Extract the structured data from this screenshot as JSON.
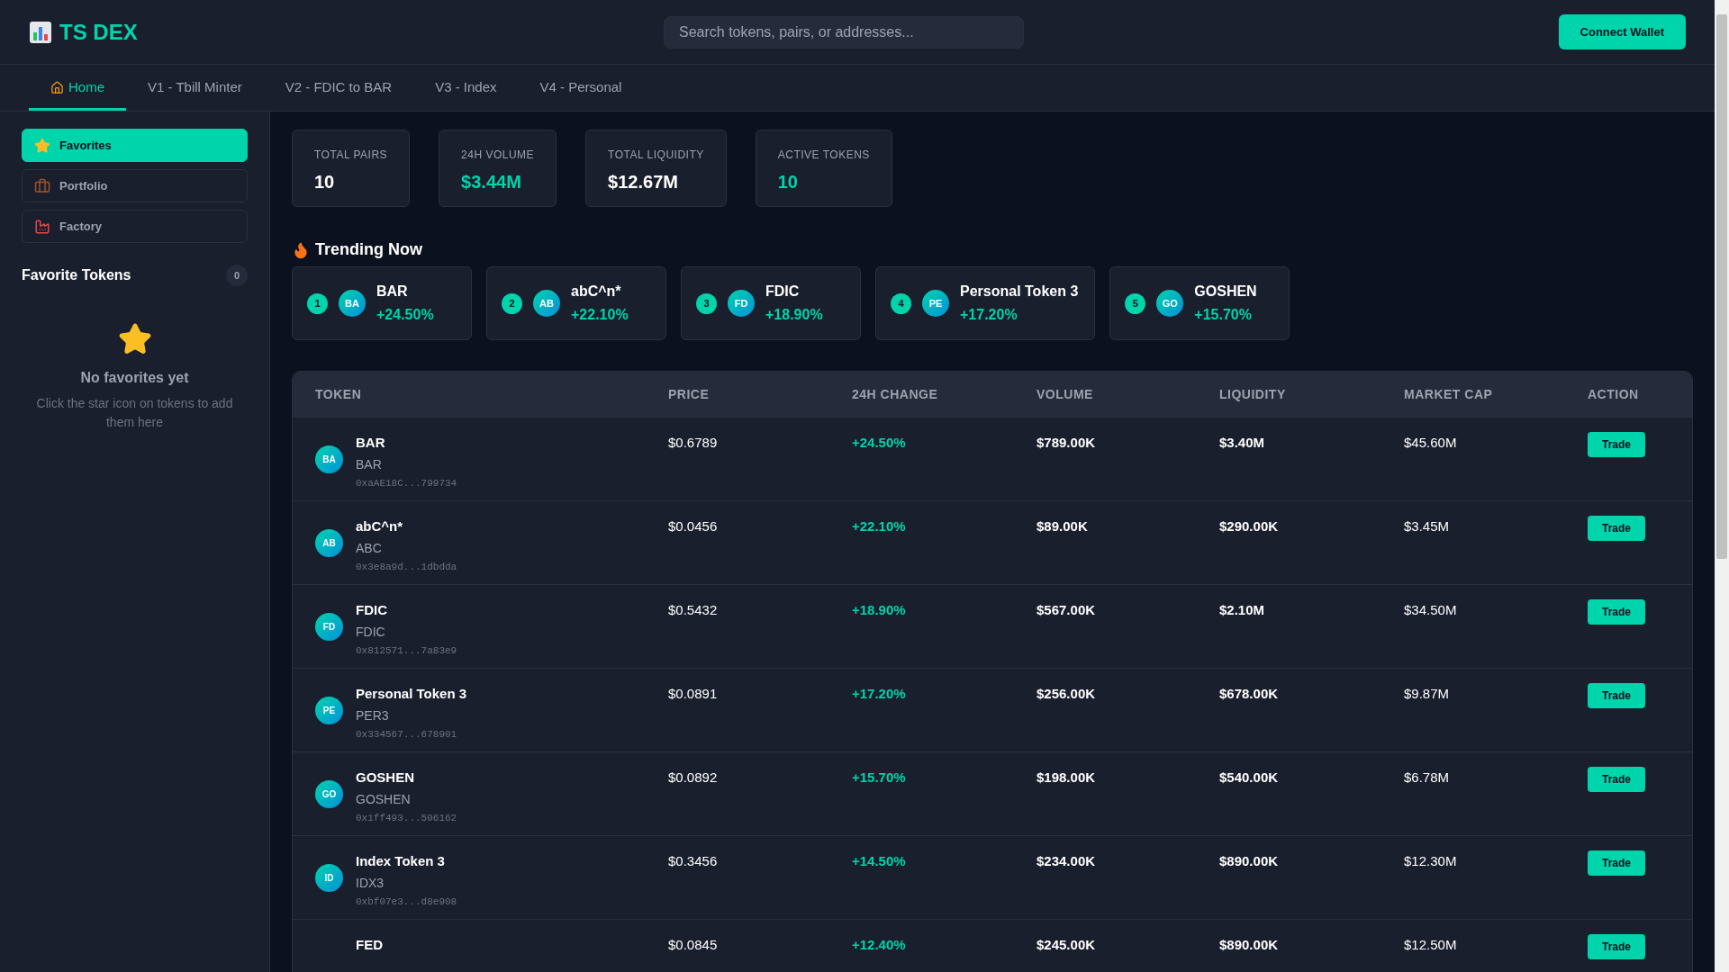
{
  "logo": {
    "text": "TS DEX"
  },
  "search": {
    "placeholder": "Search tokens, pairs, or addresses..."
  },
  "connect_button": "Connect Wallet",
  "tabs": [
    {
      "label": "Home",
      "kind": "home",
      "selected": true
    },
    {
      "label": "V1 - Tbill Minter",
      "selected": false
    },
    {
      "label": "V2 - FDIC to BAR",
      "selected": false
    },
    {
      "label": "V3 - Index",
      "selected": false
    },
    {
      "label": "V4 - Personal",
      "selected": false
    }
  ],
  "sidebar": {
    "items": [
      {
        "label": "Favorites",
        "kind": "star",
        "selected": true
      },
      {
        "label": "Portfolio",
        "kind": "briefcase",
        "selected": false
      },
      {
        "label": "Factory",
        "kind": "factory",
        "selected": false
      }
    ],
    "favorites_title": "Favorite Tokens",
    "favorites_count": "0",
    "empty_title": "No favorites yet",
    "empty_text": "Click the star icon on tokens to add them here"
  },
  "stats": [
    {
      "label": "TOTAL PAIRS",
      "value": "10",
      "highlight": false
    },
    {
      "label": "24H VOLUME",
      "value": "$3.44M",
      "highlight": true
    },
    {
      "label": "TOTAL LIQUIDITY",
      "value": "$12.67M",
      "highlight": false
    },
    {
      "label": "ACTIVE TOKENS",
      "value": "10",
      "highlight": true
    }
  ],
  "trending": {
    "title": "Trending Now",
    "items": [
      {
        "rank": "1",
        "initials": "BA",
        "name": "BAR",
        "change": "+24.50%"
      },
      {
        "rank": "2",
        "initials": "AB",
        "name": "abC^n*",
        "change": "+22.10%"
      },
      {
        "rank": "3",
        "initials": "FD",
        "name": "FDIC",
        "change": "+18.90%"
      },
      {
        "rank": "4",
        "initials": "PE",
        "name": "Personal Token 3",
        "change": "+17.20%"
      },
      {
        "rank": "5",
        "initials": "GO",
        "name": "GOSHEN",
        "change": "+15.70%"
      }
    ]
  },
  "table": {
    "columns": [
      "TOKEN",
      "PRICE",
      "24H CHANGE",
      "VOLUME",
      "LIQUIDITY",
      "MARKET CAP",
      "ACTION"
    ],
    "rows": [
      {
        "initials": "BA",
        "name": "BAR",
        "symbol": "BAR",
        "address": "0xaAE18C...799734",
        "price": "$0.6789",
        "change": "+24.50%",
        "volume": "$789.00K",
        "liquidity": "$3.40M",
        "market_cap": "$45.60M",
        "action": "Trade"
      },
      {
        "initials": "AB",
        "name": "abC^n*",
        "symbol": "ABC",
        "address": "0x3e8a9d...1dbdda",
        "price": "$0.0456",
        "change": "+22.10%",
        "volume": "$89.00K",
        "liquidity": "$290.00K",
        "market_cap": "$3.45M",
        "action": "Trade"
      },
      {
        "initials": "FD",
        "name": "FDIC",
        "symbol": "FDIC",
        "address": "0x812571...7a83e9",
        "price": "$0.5432",
        "change": "+18.90%",
        "volume": "$567.00K",
        "liquidity": "$2.10M",
        "market_cap": "$34.50M",
        "action": "Trade"
      },
      {
        "initials": "PE",
        "name": "Personal Token 3",
        "symbol": "PER3",
        "address": "0x334567...678901",
        "price": "$0.0891",
        "change": "+17.20%",
        "volume": "$256.00K",
        "liquidity": "$678.00K",
        "market_cap": "$9.87M",
        "action": "Trade"
      },
      {
        "initials": "GO",
        "name": "GOSHEN",
        "symbol": "GOSHEN",
        "address": "0x1ff493...506162",
        "price": "$0.0892",
        "change": "+15.70%",
        "volume": "$198.00K",
        "liquidity": "$540.00K",
        "market_cap": "$6.78M",
        "action": "Trade"
      },
      {
        "initials": "ID",
        "name": "Index Token 3",
        "symbol": "IDX3",
        "address": "0xbf07e3...d8e908",
        "price": "$0.3456",
        "change": "+14.50%",
        "volume": "$234.00K",
        "liquidity": "$890.00K",
        "market_cap": "$12.30M",
        "action": "Trade"
      },
      {
        "name": "FED",
        "price": "$0.0845",
        "change": "+12.40%",
        "volume": "$245.00K",
        "liquidity": "$890.00K",
        "market_cap": "$12.50M",
        "action": "Trade"
      }
    ]
  }
}
